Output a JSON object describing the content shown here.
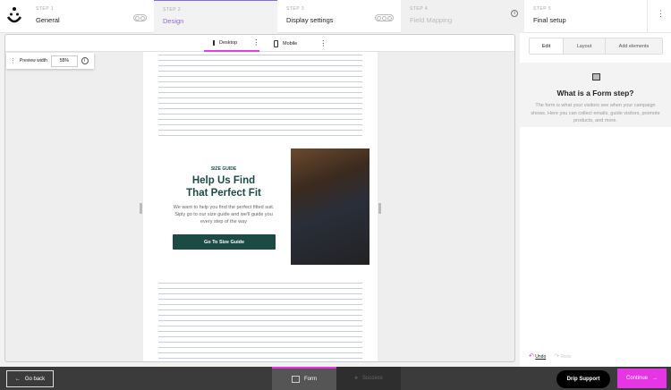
{
  "steps": [
    {
      "num": "STEP 1",
      "label": "General"
    },
    {
      "num": "STEP 2",
      "label": "Design"
    },
    {
      "num": "STEP 3",
      "label": "Display settings"
    },
    {
      "num": "STEP 4",
      "label": "Field Mapping"
    },
    {
      "num": "STEP 5",
      "label": "Final setup"
    }
  ],
  "toolbar": {
    "desktop": "Desktop",
    "mobile": "Mobile",
    "preview_width_label": "Preview width",
    "preview_width_value": "55%"
  },
  "form": {
    "tag": "SIZE GUIDE",
    "title_line1": "Help Us Find",
    "title_line2": "That Perfect Fit",
    "body": "We want to help you find the perfect fitted suit. Siply go to our size guide and we'll guide you every step of the way",
    "cta": "Go To Size Guide"
  },
  "panel": {
    "tabs": [
      "Edit",
      "Layout",
      "Add elements"
    ],
    "title": "What is a Form step?",
    "desc": "The form is what your visitors see when your campaign shows. Here you can collect emails, guide visitors, promote products, and more.",
    "undo": "Undo",
    "redo": "Redo"
  },
  "bottom": {
    "back": "Go back",
    "form": "Form",
    "success": "Success",
    "support": "Drip Support",
    "continue": "Continue"
  },
  "colors": {
    "accent": "#e535e5",
    "active_step": "#8a6bd8",
    "brand": "#1c4a45"
  }
}
